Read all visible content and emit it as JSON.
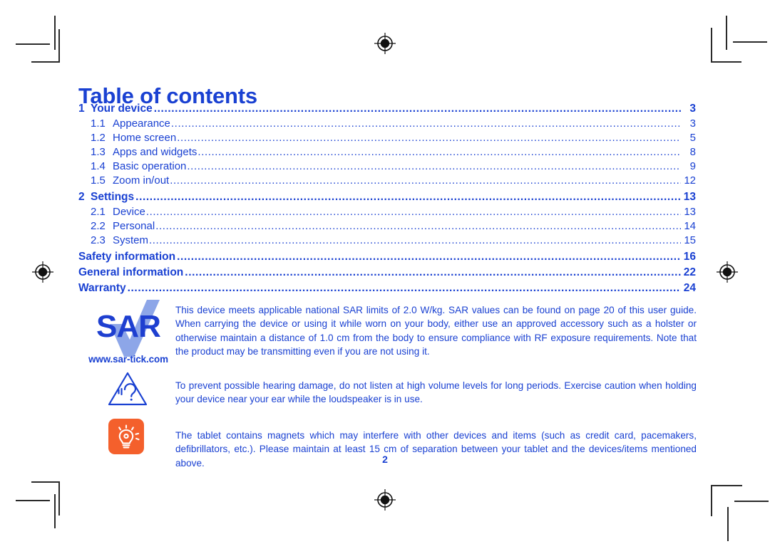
{
  "document": {
    "title": "Table of contents",
    "page_number": "2",
    "accent_color": "#1a41d2",
    "orange_color": "#f4602c",
    "sar_tick_color": "#8da6e8"
  },
  "toc": {
    "entries": [
      {
        "level": 1,
        "num": "1",
        "label": "Your device",
        "page": "3"
      },
      {
        "level": 2,
        "num": "1.1",
        "label": "Appearance",
        "page": "3"
      },
      {
        "level": 2,
        "num": "1.2",
        "label": "Home screen",
        "page": "5"
      },
      {
        "level": 2,
        "num": "1.3",
        "label": "Apps and widgets",
        "page": "8"
      },
      {
        "level": 2,
        "num": "1.4",
        "label": "Basic operation",
        "page": "9"
      },
      {
        "level": 2,
        "num": "1.5",
        "label": "Zoom in/out",
        "page": "12"
      },
      {
        "level": 1,
        "num": "2",
        "label": "Settings",
        "page": "13"
      },
      {
        "level": 2,
        "num": "2.1",
        "label": "Device",
        "page": "13"
      },
      {
        "level": 2,
        "num": "2.2",
        "label": "Personal",
        "page": "14"
      },
      {
        "level": 2,
        "num": "2.3",
        "label": "System",
        "page": "15"
      },
      {
        "level": 1,
        "num": "",
        "label": "Safety information",
        "page": "16"
      },
      {
        "level": 1,
        "num": "",
        "label": "General information",
        "page": "22"
      },
      {
        "level": 1,
        "num": "",
        "label": "Warranty",
        "page": "24"
      }
    ]
  },
  "notices": {
    "sar": {
      "icon": "sar-tick-logo",
      "logo_text": "SAR",
      "url": "www.sar-tick.com",
      "text": "This device meets applicable national SAR limits of 2.0 W/kg. SAR values can be found on page 20 of this user guide. When carrying the device or using it while worn on your body, either use an approved accessory such as a holster or otherwise maintain a distance of 1.0 cm from the body to ensure compliance with RF exposure requirements. Note that the product may be transmitting even if you are not using it."
    },
    "hearing": {
      "icon": "ear-warning-triangle-icon",
      "text": "To prevent possible hearing damage, do not listen at high volume levels for long periods. Exercise caution when holding your device near your ear while the loudspeaker is in use."
    },
    "magnets": {
      "icon": "lightbulb-tip-icon",
      "text": "The tablet contains magnets which may interfere with other devices and items (such as credit card, pacemakers, defibrillators, etc.). Please maintain at least 15 cm of separation between your tablet and the devices/items mentioned above."
    }
  }
}
